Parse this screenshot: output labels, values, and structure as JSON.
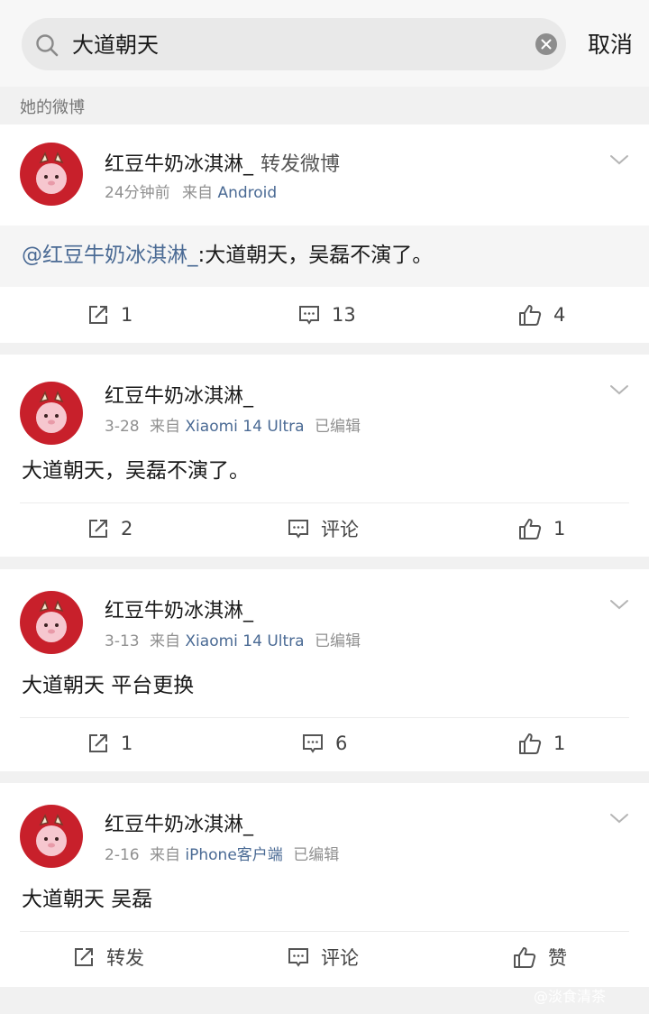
{
  "search": {
    "query": "大道朝天",
    "cancel_label": "取消"
  },
  "section_label": "她的微博",
  "posts": [
    {
      "username": "红豆牛奶冰淇淋_",
      "repost_tag": "转发微博",
      "time": "24分钟前",
      "from_label": "来自",
      "source": "Android",
      "edited": "",
      "mention": "@红豆牛奶冰淇淋_",
      "text": ":大道朝天，吴磊不演了。",
      "shares": "1",
      "comments": "13",
      "likes": "4"
    },
    {
      "username": "红豆牛奶冰淇淋_",
      "time": "3-28",
      "from_label": "来自",
      "source": "Xiaomi 14 Ultra",
      "edited": "已编辑",
      "text": "大道朝天，吴磊不演了。",
      "shares": "2",
      "comments": "评论",
      "likes": "1"
    },
    {
      "username": "红豆牛奶冰淇淋_",
      "time": "3-13",
      "from_label": "来自",
      "source": "Xiaomi 14 Ultra",
      "edited": "已编辑",
      "text": "大道朝天 平台更换",
      "shares": "1",
      "comments": "6",
      "likes": "1"
    },
    {
      "username": "红豆牛奶冰淇淋_",
      "time": "2-16",
      "from_label": "来自",
      "source": "iPhone客户端",
      "edited": "已编辑",
      "text": "大道朝天 吴磊",
      "shares": "转发",
      "comments": "评论",
      "likes": "赞"
    }
  ],
  "watermark": "@淡食清茶",
  "colors": {
    "link": "#4a6a94",
    "background": "#f1f1f1",
    "avatar": "#c8202b"
  }
}
